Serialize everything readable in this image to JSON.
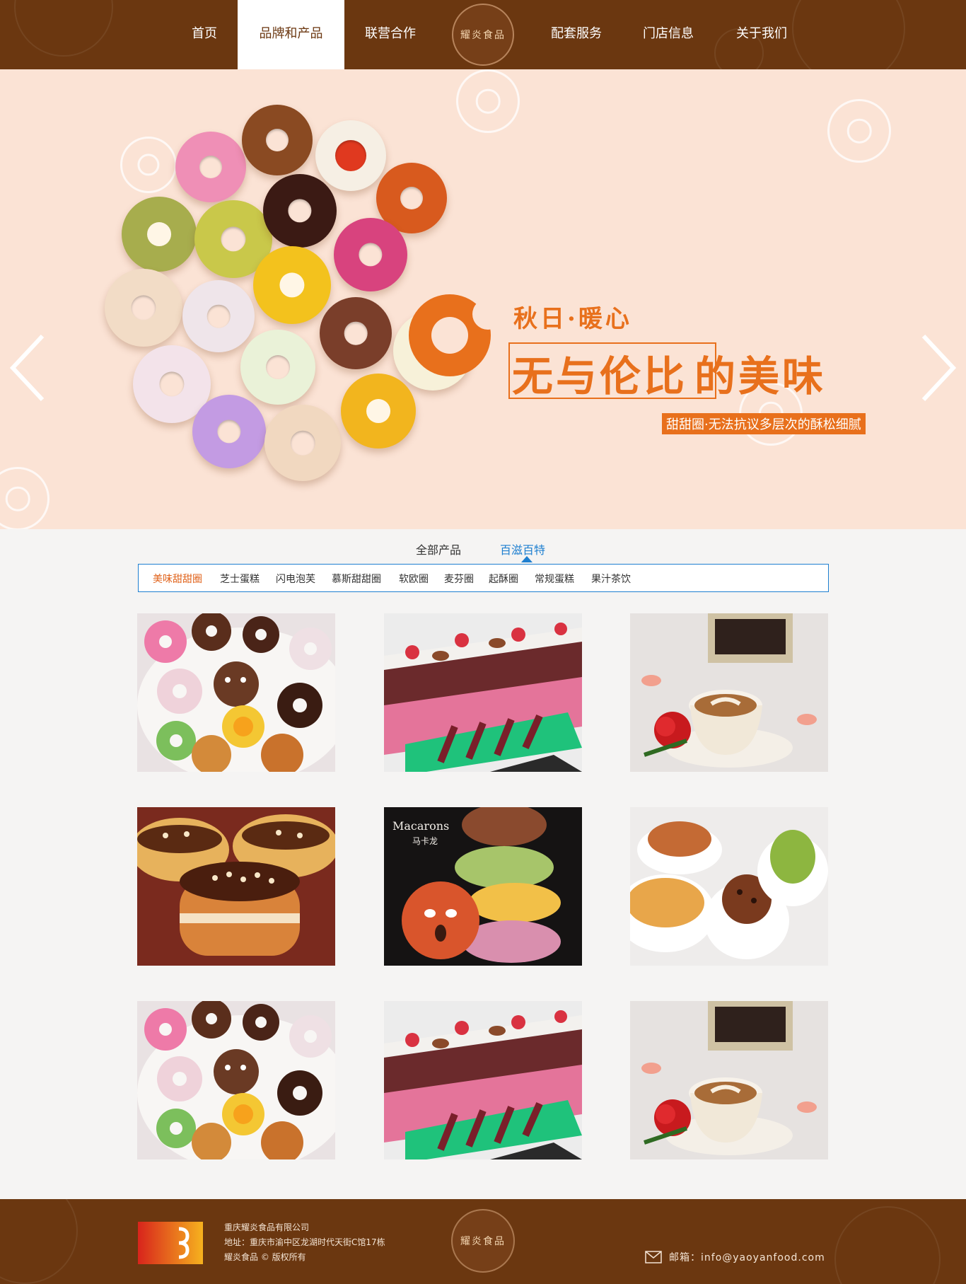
{
  "nav": {
    "items": [
      {
        "label": "首页"
      },
      {
        "label": "品牌和产品"
      },
      {
        "label": "联营合作"
      },
      {
        "label": "配套服务"
      },
      {
        "label": "门店信息"
      },
      {
        "label": "关于我们"
      }
    ],
    "active": "品牌和产品",
    "logo_text": "耀炎食品"
  },
  "banner": {
    "slogan_top": "秋日·暖心",
    "slogan_main_boxed": "无与伦比",
    "slogan_main_rest": "的美味",
    "slogan_sub": "甜甜圈·无法抗议多层次的酥松细腻",
    "prev_icon": "chevron-left-icon",
    "next_icon": "chevron-right-icon"
  },
  "products": {
    "tabs": [
      {
        "label": "全部产品"
      },
      {
        "label": "百滋百特"
      }
    ],
    "active_tab": "百滋百特",
    "categories": [
      {
        "label": "美味甜甜圈"
      },
      {
        "label": "芝士蛋糕"
      },
      {
        "label": "闪电泡芙"
      },
      {
        "label": "慕斯甜甜圈"
      },
      {
        "label": "软欧圈"
      },
      {
        "label": "麦芬圈"
      },
      {
        "label": "起酥圈"
      },
      {
        "label": "常规蛋糕"
      },
      {
        "label": "果汁茶饮"
      }
    ],
    "active_category": "美味甜甜圈",
    "grid": [
      {
        "image": "donut-platter"
      },
      {
        "image": "eclair"
      },
      {
        "image": "latte-and-rose"
      },
      {
        "image": "nut-topped-donuts"
      },
      {
        "image": "macarons",
        "caption": "Macarons",
        "caption_cn": "马卡龙"
      },
      {
        "image": "cookies-in-bowls"
      },
      {
        "image": "donut-platter"
      },
      {
        "image": "eclair"
      },
      {
        "image": "latte-and-rose"
      }
    ]
  },
  "footer": {
    "company": "重庆耀炎食品有限公司",
    "address": "地址：重庆市渝中区龙湖时代天街C馆17栋",
    "copyright": "耀炎食品 © 版权所有",
    "badge_text": "耀炎食品",
    "email_label": "邮箱：info@yaoyanfood.com",
    "mail_icon": "mail-icon"
  },
  "colors": {
    "brown": "#6b3710",
    "orange": "#e8701c",
    "banner_bg": "#fbe3d5",
    "accent_blue": "#1e7fd0"
  }
}
